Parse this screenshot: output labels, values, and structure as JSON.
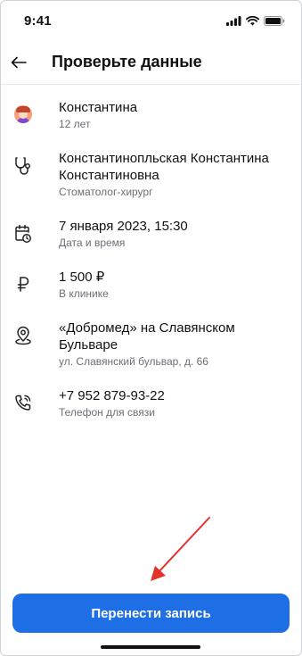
{
  "status_bar": {
    "time": "9:41"
  },
  "header": {
    "title": "Проверьте данные"
  },
  "details": [
    {
      "icon": "avatar-icon",
      "primary": "Константина",
      "secondary": "12 лет"
    },
    {
      "icon": "stethoscope-icon",
      "primary": "Константинопльская Константина Константиновна",
      "secondary": "Стоматолог-хирург"
    },
    {
      "icon": "calendar-clock-icon",
      "primary": "7 января 2023, 15:30",
      "secondary": "Дата и время"
    },
    {
      "icon": "ruble-icon",
      "primary": "1 500 ₽",
      "secondary": "В клинике"
    },
    {
      "icon": "map-pin-icon",
      "primary": "«Добромед» на Славянском Бульваре",
      "secondary": "ул. Славянский бульвар, д. 66"
    },
    {
      "icon": "phone-icon",
      "primary": "+7 952 879-93-22",
      "secondary": "Телефон для связи"
    }
  ],
  "actions": {
    "reschedule_label": "Перенести запись"
  },
  "colors": {
    "primary_button": "#1e6fe5",
    "annotation_arrow": "#e3312b",
    "secondary_text": "#6b6f76"
  }
}
